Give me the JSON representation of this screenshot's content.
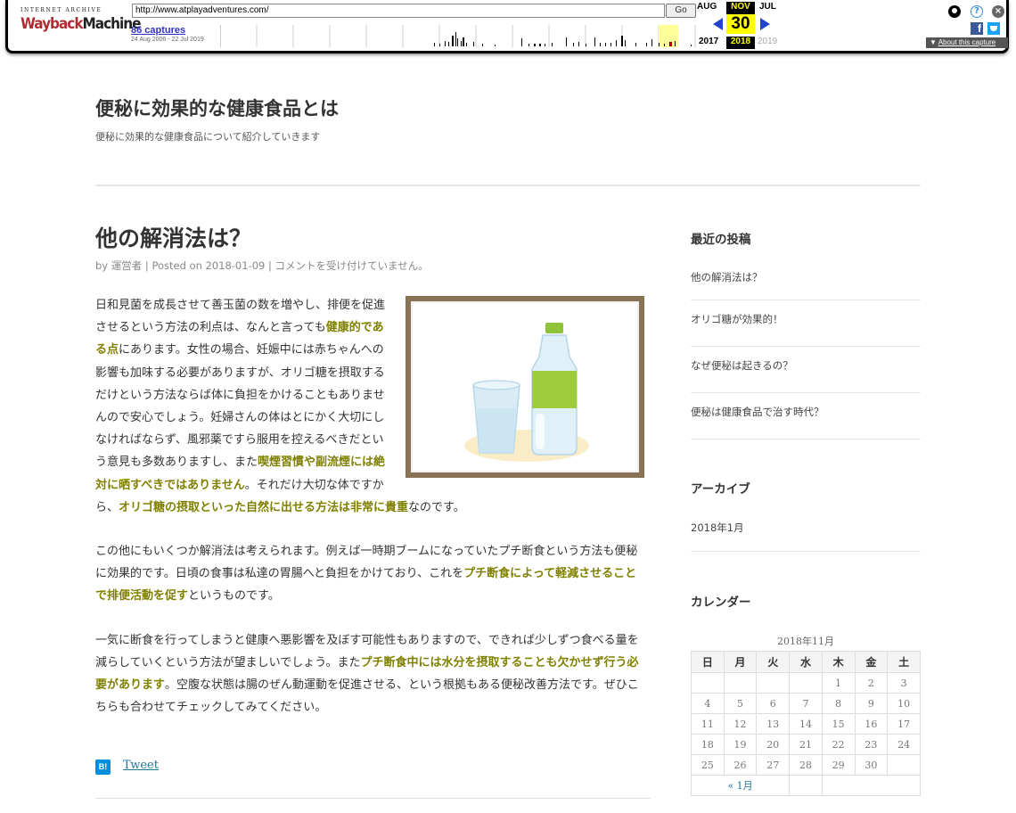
{
  "wayback": {
    "logo_top": "INTERNET ARCHIVE",
    "logo_way": "Wayback",
    "logo_machine": "Machine",
    "url": "http://www.atplayadventures.com/",
    "go_label": "Go",
    "captures_count": "86 captures",
    "captures_range": "24 Aug 2006 - 22 Jul 2019",
    "prev_month": "AUG",
    "cur_month": "NOV",
    "next_month": "JUL",
    "cur_day": "30",
    "prev_year": "2017",
    "cur_year": "2018",
    "next_year": "2019",
    "about_label": "About this capture",
    "fb_label": "f"
  },
  "site": {
    "title": "便秘に効果的な健康食品とは",
    "description": "便秘に効果的な健康食品について紹介していきます"
  },
  "post": {
    "title": "他の解消法は？",
    "meta": "by 運営者 | Posted on 2018-01-09 | コメントを受け付けていません。",
    "p1": [
      {
        "t": "日和見菌を成長させて善玉菌の数を増やし、排便を促進させるという方法の利点は、なんと言っても",
        "b": false
      },
      {
        "t": "健康的である点",
        "b": true
      },
      {
        "t": "にあります。女性の場合、妊娠中には赤ちゃんへの影響も加味する必要がありますが、オリゴ糖を摂取するだけという方法ならば体に負担をかけることもありませんので安心でしょう。妊婦さんの体はとにかく大切にしなければならず、風邪薬ですら服用を控えるべきだという意見も多数ありますし、また",
        "b": false
      },
      {
        "t": "喫煙習慣や副流煙には絶対に晒すべきではありません",
        "b": true
      },
      {
        "t": "。それだけ大切な体ですから、",
        "b": false
      },
      {
        "t": "オリゴ糖の摂取といった自然に出せる方法は非常に貴重",
        "b": true
      },
      {
        "t": "なのです。",
        "b": false
      }
    ],
    "p2": [
      {
        "t": "この他にもいくつか解消法は考えられます。例えば一時期ブームになっていたプチ断食という方法も便秘に効果的です。日頃の食事は私達の胃腸へと負担をかけており、これを",
        "b": false
      },
      {
        "t": "プチ断食によって軽減させることで排便活動を促す",
        "b": true
      },
      {
        "t": "というものです。",
        "b": false
      }
    ],
    "p3": [
      {
        "t": "一気に断食を行ってしまうと健康へ悪影響を及ぼす可能性もありますので、できれば少しずつ食べる量を減らしていくという方法が望ましいでしょう。また",
        "b": false
      },
      {
        "t": "プチ断食中には水分を摂取することも欠かせず行う必要があります",
        "b": true
      },
      {
        "t": "。空腹な状態は腸のぜん動運動を促進させる、という根拠もある便秘改善方法です。ぜひこちらも合わせてチェックしてみてください。",
        "b": false
      }
    ],
    "hatena_label": "B!",
    "tweet_label": "Tweet"
  },
  "sidebar": {
    "recent_title": "最近の投稿",
    "recent": [
      "他の解消法は？",
      "オリゴ糖が効果的！",
      "なぜ便秘は起きるの？",
      "便秘は健康食品で治す時代？"
    ],
    "archive_title": "アーカイブ",
    "archive": "2018年1月",
    "calendar_title": "カレンダー",
    "calendar_caption": "2018年11月",
    "weekdays": [
      "日",
      "月",
      "火",
      "水",
      "木",
      "金",
      "土"
    ],
    "weeks": [
      [
        "",
        "",
        "",
        "",
        "1",
        "2",
        "3"
      ],
      [
        "4",
        "5",
        "6",
        "7",
        "8",
        "9",
        "10"
      ],
      [
        "11",
        "12",
        "13",
        "14",
        "15",
        "16",
        "17"
      ],
      [
        "18",
        "19",
        "20",
        "21",
        "22",
        "23",
        "24"
      ],
      [
        "25",
        "26",
        "27",
        "28",
        "29",
        "30",
        ""
      ]
    ],
    "prev_month": "« 1月"
  }
}
